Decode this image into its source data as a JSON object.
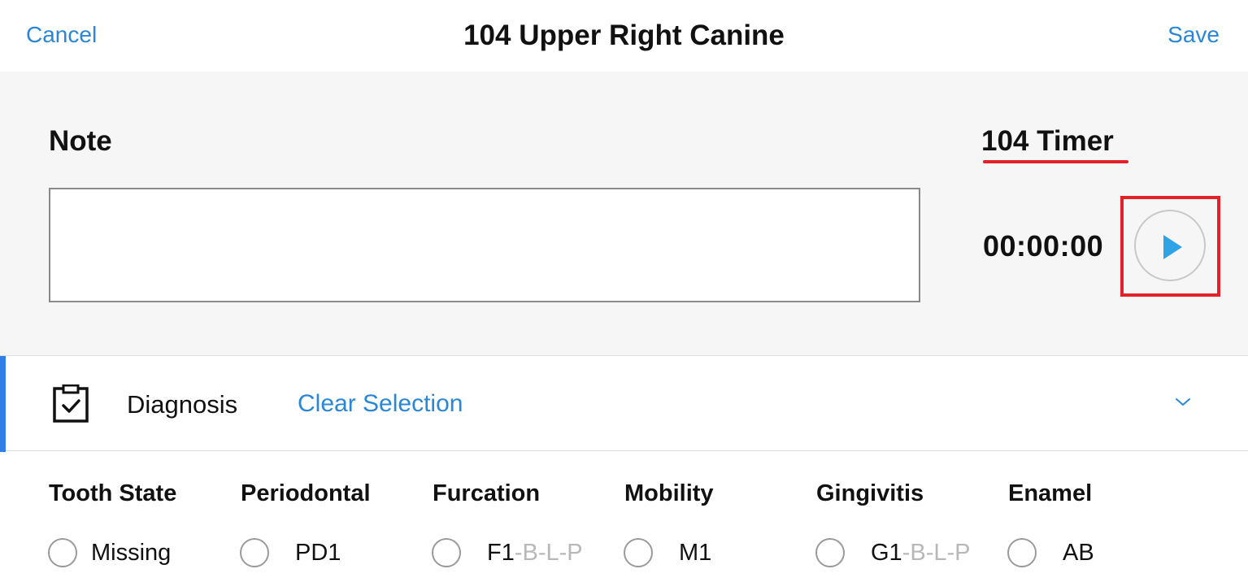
{
  "header": {
    "cancel_label": "Cancel",
    "title": "104 Upper Right Canine",
    "save_label": "Save"
  },
  "note": {
    "label": "Note",
    "value": ""
  },
  "timer": {
    "label": "104 Timer",
    "value": "00:00:00",
    "play_icon": "play-icon"
  },
  "diagnosis": {
    "icon": "clipboard-check-icon",
    "label": "Diagnosis",
    "clear_label": "Clear Selection",
    "chevron_icon": "chevron-down-icon"
  },
  "categories": [
    {
      "title": "Tooth State",
      "option": "Missing",
      "suffix": ""
    },
    {
      "title": "Periodontal",
      "option": "PD1",
      "suffix": ""
    },
    {
      "title": "Furcation",
      "option": "F1",
      "suffix": "-B-L-P"
    },
    {
      "title": "Mobility",
      "option": "M1",
      "suffix": ""
    },
    {
      "title": "Gingivitis",
      "option": "G1",
      "suffix": "-B-L-P"
    },
    {
      "title": "Enamel",
      "option": "AB",
      "suffix": ""
    }
  ],
  "colors": {
    "accent_blue": "#2a86d6",
    "highlight_red": "#e32129",
    "panel_bg": "#f6f6f6",
    "play_blue": "#2fa3e6"
  }
}
